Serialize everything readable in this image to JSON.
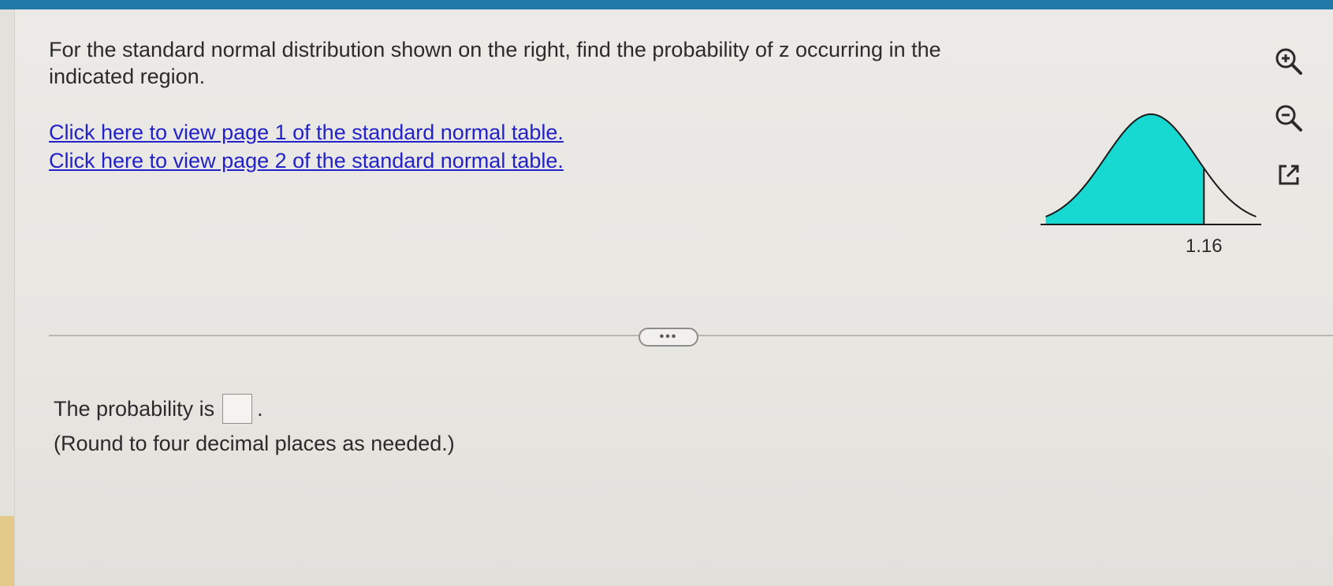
{
  "question": {
    "text": "For the standard normal distribution shown on the right, find the probability of z occurring in the indicated region."
  },
  "links": [
    {
      "label": "Click here to view page 1 of the standard normal table."
    },
    {
      "label": "Click here to view page 2 of the standard normal table."
    }
  ],
  "graph": {
    "z_value": 1.16,
    "z_label": "1.16",
    "shaded_region": "left of z",
    "fill_color": "#18d9d2"
  },
  "tools": [
    {
      "icon": "zoom-in-icon"
    },
    {
      "icon": "zoom-out-icon"
    },
    {
      "icon": "popout-icon"
    }
  ],
  "divider": {
    "more_label": "•••"
  },
  "answer": {
    "prefix": "The probability is",
    "value": "",
    "suffix": ".",
    "hint": "(Round to four decimal places as needed.)"
  },
  "colors": {
    "top_bar": "#1f78a8",
    "link": "#2222c8",
    "text": "#2b2b2b"
  }
}
